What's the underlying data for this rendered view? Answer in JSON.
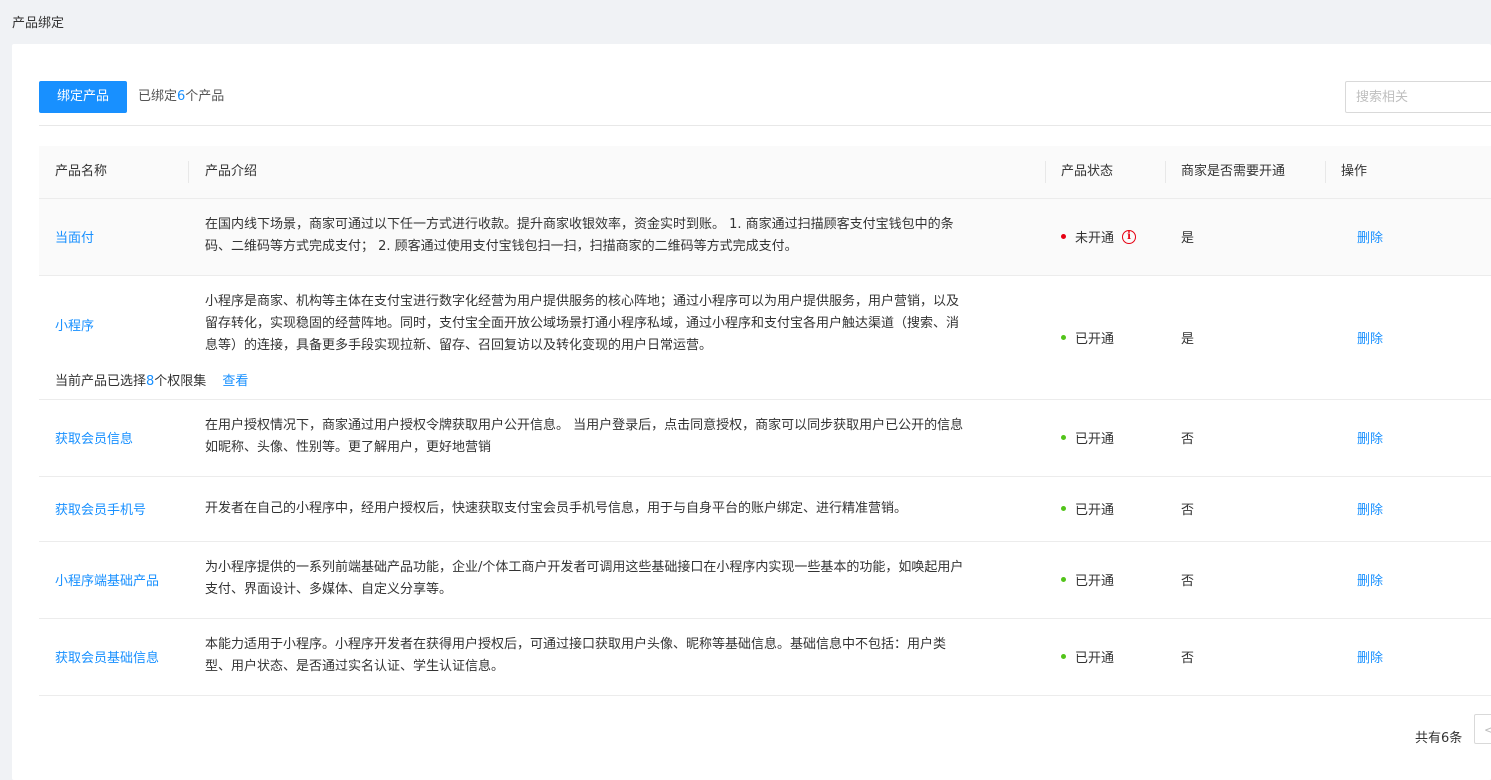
{
  "breadcrumb": "产品绑定",
  "toolbar": {
    "bind_button": "绑定产品",
    "bound_prefix": "已绑定",
    "bound_count": "6",
    "bound_suffix": "个产品",
    "search_placeholder": "搜索相关"
  },
  "table": {
    "headers": {
      "name": "产品名称",
      "desc": "产品介绍",
      "status": "产品状态",
      "needs_open": "商家是否需要开通",
      "action": "操作"
    },
    "rows": [
      {
        "name": "当面付",
        "desc_lines": [
          "在国内线下场景，商家可通过以下任一方式进行收款。提升商家收银效率，资金实时到账。 1. 商家通过扫描顾客支付宝钱包中的条",
          "码、二维码等方式完成支付； 2. 顾客通过使用支付宝钱包扫一扫，扫描商家的二维码等方式完成支付。"
        ],
        "status": "未开通",
        "needs_open": "是",
        "action": "删除"
      },
      {
        "name": "小程序",
        "desc_lines": [
          "小程序是商家、机构等主体在支付宝进行数字化经营为用户提供服务的核心阵地；通过小程序可以为用户提供服务，用户营销，以及",
          "留存转化，实现稳固的经营阵地。同时，支付宝全面开放公域场景打通小程序私域，通过小程序和支付宝各用户触达渠道（搜索、消",
          "息等）的连接，具备更多手段实现拉新、留存、召回复访以及转化变现的用户日常运营。"
        ],
        "status": "已开通",
        "needs_open": "是",
        "action": "删除",
        "sub_prefix": "当前产品已选择",
        "sub_count": "8",
        "sub_suffix": "个权限集",
        "sub_view": "查看"
      },
      {
        "name": "获取会员信息",
        "desc_lines": [
          "在用户授权情况下，商家通过用户授权令牌获取用户公开信息。 当用户登录后，点击同意授权，商家可以同步获取用户已公开的信息",
          "如昵称、头像、性别等。更了解用户，更好地营销"
        ],
        "status": "已开通",
        "needs_open": "否",
        "action": "删除"
      },
      {
        "name": "获取会员手机号",
        "desc_lines": [
          "开发者在自己的小程序中，经用户授权后，快速获取支付宝会员手机号信息，用于与自身平台的账户绑定、进行精准营销。"
        ],
        "status": "已开通",
        "needs_open": "否",
        "action": "删除"
      },
      {
        "name": "小程序端基础产品",
        "desc_lines": [
          "为小程序提供的一系列前端基础产品功能，企业/个体工商户开发者可调用这些基础接口在小程序内实现一些基本的功能，如唤起用户",
          "支付、界面设计、多媒体、自定义分享等。"
        ],
        "status": "已开通",
        "needs_open": "否",
        "action": "删除"
      },
      {
        "name": "获取会员基础信息",
        "desc_lines": [
          "本能力适用于小程序。小程序开发者在获得用户授权后，可通过接口获取用户头像、昵称等基础信息。基础信息中不包括：用户类",
          "型、用户状态、是否通过实名认证、学生认证信息。"
        ],
        "status": "已开通",
        "needs_open": "否",
        "action": "删除"
      }
    ]
  },
  "footer": {
    "total": "共有6条",
    "prev_icon": "chevron-left-icon"
  },
  "colors": {
    "primary": "#1890ff",
    "status_off": "#e60012",
    "status_on": "#52c41a"
  }
}
